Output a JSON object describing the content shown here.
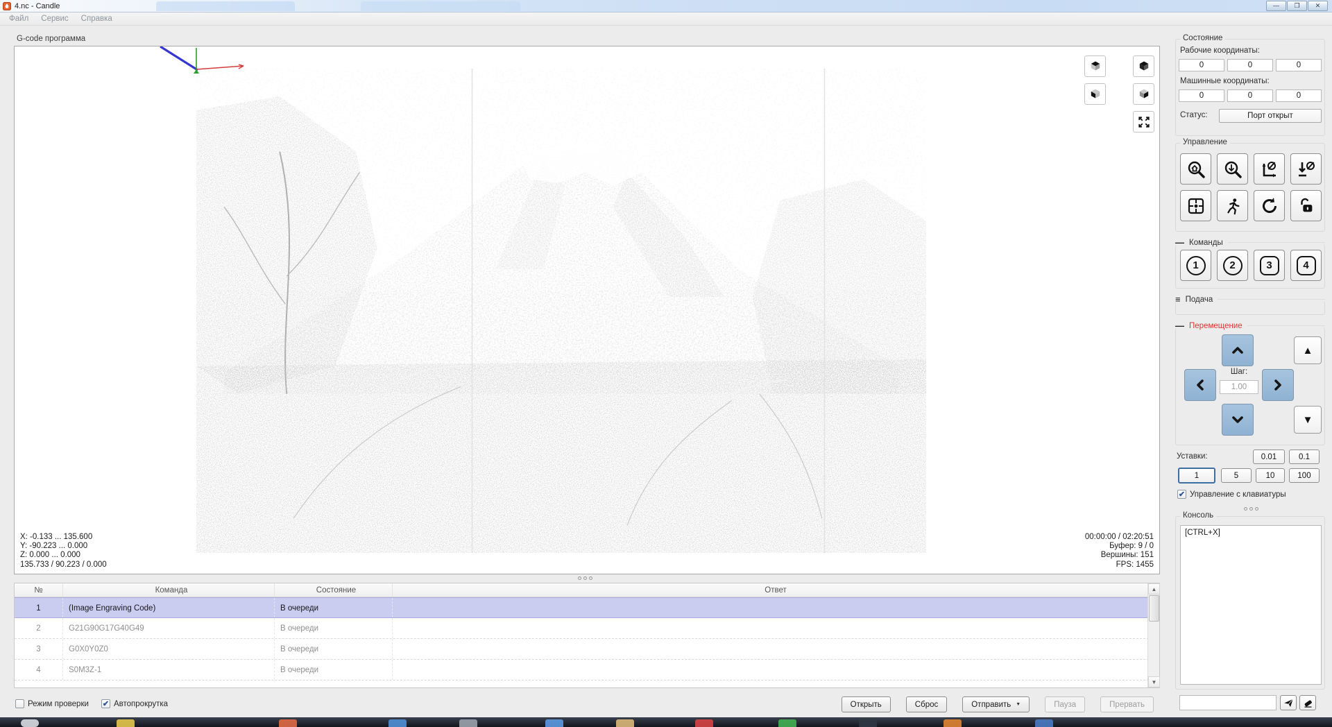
{
  "window": {
    "title": "4.nc - Candle",
    "controls": {
      "minimize": "—",
      "maximize": "❐",
      "close": "✕"
    },
    "menu": [
      "Файл",
      "Сервис",
      "Справка"
    ]
  },
  "visualizer": {
    "section_label": "G-code программа",
    "stats_left": [
      "X: -0.133 ... 135.600",
      "Y: -90.223 ... 0.000",
      "Z: 0.000 ... 0.000",
      "135.733 / 90.223 / 0.000"
    ],
    "stats_right": [
      "00:00:00 / 02:20:51",
      "Буфер: 9 / 0",
      "Вершины: 151",
      "FPS: 1455"
    ]
  },
  "state_panel": {
    "title": "Состояние",
    "work_label": "Рабочие координаты:",
    "work_coords": [
      "0",
      "0",
      "0"
    ],
    "machine_label": "Машинные координаты:",
    "machine_coords": [
      "0",
      "0",
      "0"
    ],
    "status_label": "Статус:",
    "status_value": "Порт открыт"
  },
  "control_panel": {
    "title": "Управление"
  },
  "commands_panel": {
    "title": "Команды",
    "buttons": [
      "1",
      "2",
      "3",
      "4"
    ]
  },
  "feed_panel": {
    "title": "Подача"
  },
  "jog_panel": {
    "title": "Перемещение",
    "step_label": "Шаг:",
    "step_value": "1.00",
    "presets_label": "Уставки:",
    "presets": [
      "0.01",
      "0.1",
      "1",
      "5",
      "10",
      "100"
    ],
    "keyboard_checkbox": "Управление с клавиатуры"
  },
  "console_panel": {
    "title": "Консоль",
    "log": "[CTRL+X]",
    "input_value": ""
  },
  "program_table": {
    "headers": [
      "№",
      "Команда",
      "Состояние",
      "Ответ"
    ],
    "rows": [
      {
        "n": "1",
        "command": "(Image Engraving Code)",
        "state": "В очереди",
        "response": ""
      },
      {
        "n": "2",
        "command": "G21G90G17G40G49",
        "state": "В очереди",
        "response": ""
      },
      {
        "n": "3",
        "command": "G0X0Y0Z0",
        "state": "В очереди",
        "response": ""
      },
      {
        "n": "4",
        "command": "S0M3Z-1",
        "state": "В очереди",
        "response": ""
      }
    ]
  },
  "bottom_bar": {
    "check_mode": "Режим проверки",
    "autoscroll": "Автопрокрутка",
    "open": "Открыть",
    "reset": "Сброс",
    "send": "Отправить",
    "pause": "Пауза",
    "abort": "Прервать"
  },
  "icons": {
    "z_up": "▲",
    "z_down": "▼",
    "check": "✔",
    "collapse": "—",
    "stack": "≡",
    "dropdown": "▼",
    "scroll_up": "▲",
    "scroll_down": "▼"
  },
  "colors": {
    "jog_blue": "#8fb2d3",
    "selection": "#cbcdf0",
    "section_red": "#e03333",
    "port_ok_text": "#1a1a1a"
  }
}
